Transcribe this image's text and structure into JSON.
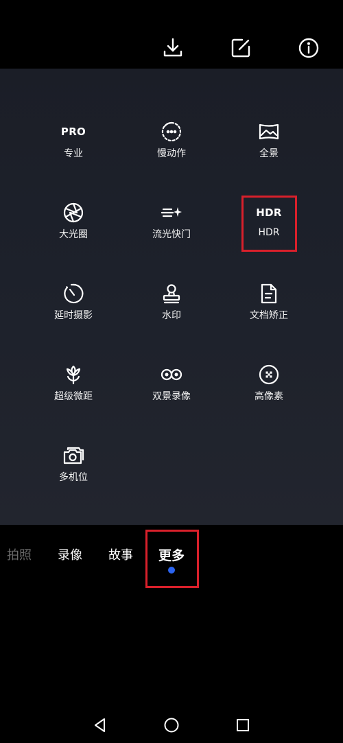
{
  "top_bar": {
    "icons": [
      "download-icon",
      "edit-icon",
      "info-icon"
    ]
  },
  "modes": [
    {
      "icon": "PRO",
      "label": "专业"
    },
    {
      "icon": "slow-motion-icon",
      "label": "慢动作"
    },
    {
      "icon": "panorama-icon",
      "label": "全景"
    },
    {
      "icon": "aperture-icon",
      "label": "大光圈"
    },
    {
      "icon": "light-trail-icon",
      "label": "流光快门"
    },
    {
      "icon": "HDR",
      "label": "HDR"
    },
    {
      "icon": "timelapse-icon",
      "label": "延时摄影"
    },
    {
      "icon": "stamp-icon",
      "label": "水印"
    },
    {
      "icon": "document-icon",
      "label": "文档矫正"
    },
    {
      "icon": "flower-icon",
      "label": "超级微距"
    },
    {
      "icon": "dual-view-icon",
      "label": "双景录像"
    },
    {
      "icon": "high-res-icon",
      "label": "高像素"
    },
    {
      "icon": "multi-camera-icon",
      "label": "多机位"
    }
  ],
  "tabs": [
    {
      "label": "拍照",
      "state": "dim"
    },
    {
      "label": "录像",
      "state": "normal"
    },
    {
      "label": "故事",
      "state": "normal"
    },
    {
      "label": "更多",
      "state": "active"
    }
  ],
  "colors": {
    "highlight": "#d9202b",
    "active_dot": "#2b64f0",
    "panel_bg": "#1d212b"
  },
  "nav": [
    "back-icon",
    "home-icon",
    "recents-icon"
  ]
}
